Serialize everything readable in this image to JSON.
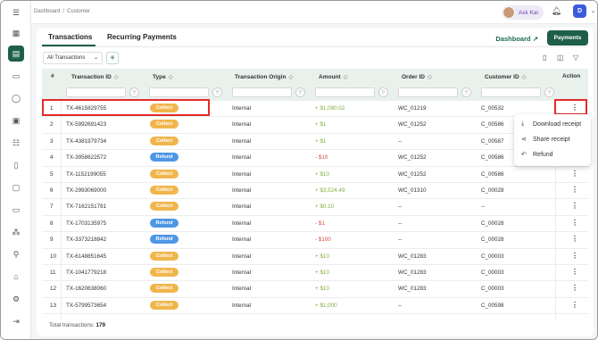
{
  "breadcrumb": {
    "root": "Dashboard",
    "current": "Customer"
  },
  "user": {
    "name": "Ask Kai",
    "initial": "D"
  },
  "tabs": [
    "Transactions",
    "Recurring Payments"
  ],
  "header_actions": {
    "dashboard_link": "Dashboard",
    "payments_button": "Payments"
  },
  "filter": {
    "selected": "All Transactions"
  },
  "table": {
    "columns": [
      "#",
      "Transaction ID",
      "Type",
      "Transaction Origin",
      "Amount",
      "Order ID",
      "Customer ID",
      "Action"
    ],
    "rows": [
      {
        "n": "1",
        "id": "TX-4615829755",
        "type": "Collect",
        "origin": "Internal",
        "amount": "+ $1,090.02",
        "order": "WC_01219",
        "customer": "C_00532"
      },
      {
        "n": "2",
        "id": "TX-5992691423",
        "type": "Collect",
        "origin": "Internal",
        "amount": "+ $1",
        "order": "WC_01252",
        "customer": "C_00586"
      },
      {
        "n": "3",
        "id": "TX-4381979734",
        "type": "Collect",
        "origin": "Internal",
        "amount": "+ $1",
        "order": "--",
        "customer": "C_00587"
      },
      {
        "n": "4",
        "id": "TX-3958622572",
        "type": "Refund",
        "origin": "Internal",
        "amount": "- $10",
        "order": "WC_01252",
        "customer": "C_00586"
      },
      {
        "n": "5",
        "id": "TX-1152199055",
        "type": "Collect",
        "origin": "Internal",
        "amount": "+ $10",
        "order": "WC_01252",
        "customer": "C_00586"
      },
      {
        "n": "6",
        "id": "TX-2993069000",
        "type": "Collect",
        "origin": "Internal",
        "amount": "+ $3,524.49",
        "order": "WC_01310",
        "customer": "C_00028"
      },
      {
        "n": "7",
        "id": "TX-7162151781",
        "type": "Collect",
        "origin": "Internal",
        "amount": "+ $0.10",
        "order": "--",
        "customer": "--"
      },
      {
        "n": "8",
        "id": "TX-1703135975",
        "type": "Refund",
        "origin": "Internal",
        "amount": "- $1",
        "order": "--",
        "customer": "C_00028"
      },
      {
        "n": "9",
        "id": "TX-3373218842",
        "type": "Refund",
        "origin": "Internal",
        "amount": "- $100",
        "order": "--",
        "customer": "C_00028"
      },
      {
        "n": "10",
        "id": "TX-6148851645",
        "type": "Collect",
        "origin": "Internal",
        "amount": "+ $10",
        "order": "WC_01283",
        "customer": "C_00003"
      },
      {
        "n": "11",
        "id": "TX-1041779218",
        "type": "Collect",
        "origin": "Internal",
        "amount": "+ $10",
        "order": "WC_01283",
        "customer": "C_00003"
      },
      {
        "n": "12",
        "id": "TX-1620638060",
        "type": "Collect",
        "origin": "Internal",
        "amount": "+ $10",
        "order": "WC_01283",
        "customer": "C_00003"
      },
      {
        "n": "13",
        "id": "TX-5799573654",
        "type": "Collect",
        "origin": "Internal",
        "amount": "+ $1,000",
        "order": "--",
        "customer": "C_00598"
      }
    ]
  },
  "footer": {
    "label": "Total transactions:",
    "count": "179"
  },
  "context_menu": {
    "items": [
      "Download receipt",
      "Share receipt",
      "Refund"
    ]
  },
  "colors": {
    "brand": "#1f5f4a",
    "collect": "#f0b64d",
    "refund": "#4f96e6",
    "positive": "#7fae3d",
    "negative": "#d24c3d",
    "highlight": "#e42a2a"
  }
}
